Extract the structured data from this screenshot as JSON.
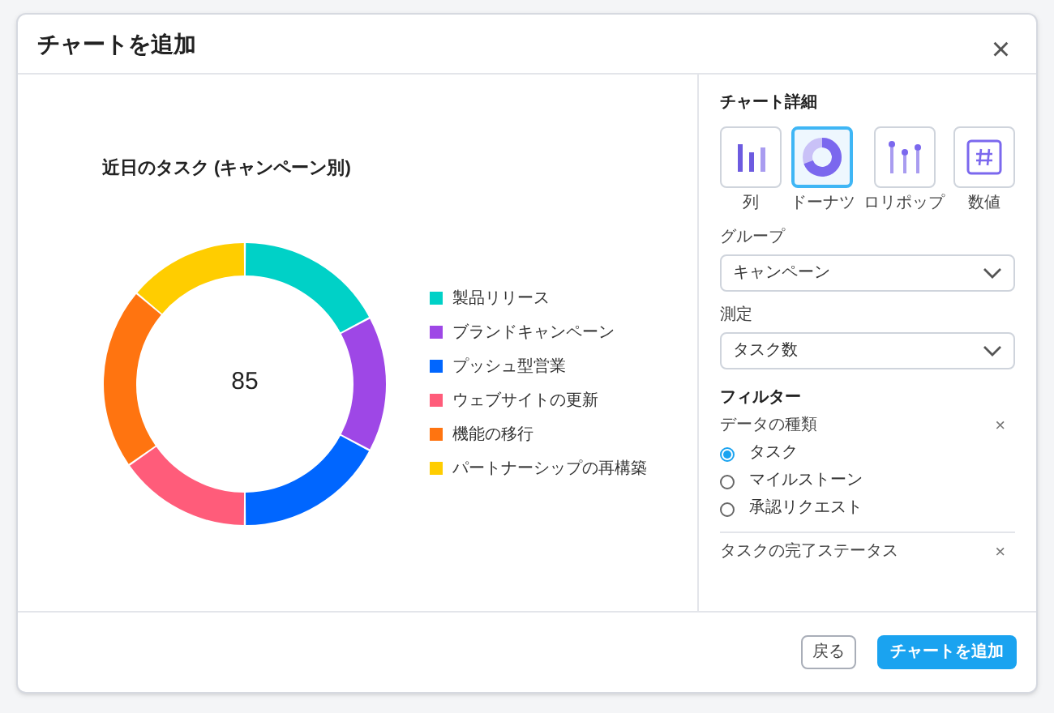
{
  "dialog": {
    "title": "チャートを追加",
    "close": "×"
  },
  "chart": {
    "title": "近日のタスク (キャンペーン別)",
    "center": "85",
    "legend": [
      {
        "label": "製品リリース",
        "color": "#00d1c7"
      },
      {
        "label": "ブランドキャンペーン",
        "color": "#9e47e6"
      },
      {
        "label": "プッシュ型営業",
        "color": "#0066ff"
      },
      {
        "label": "ウェブサイトの更新",
        "color": "#ff5c7a"
      },
      {
        "label": "機能の移行",
        "color": "#ff7410"
      },
      {
        "label": "パートナーシップの再構築",
        "color": "#ffcd00"
      }
    ]
  },
  "details": {
    "title": "チャート詳細",
    "types": [
      {
        "kind": "column",
        "label": "列",
        "selected": false
      },
      {
        "kind": "donut",
        "label": "ドーナツ",
        "selected": true
      },
      {
        "kind": "lollipop",
        "label": "ロリポップ",
        "selected": false
      },
      {
        "kind": "number",
        "label": "数値",
        "selected": false
      }
    ],
    "group": {
      "label": "グループ",
      "value": "キャンペーン"
    },
    "measure": {
      "label": "測定",
      "value": "タスク数"
    }
  },
  "filters": {
    "title": "フィルター",
    "sections": [
      {
        "label": "データの種類",
        "remove": "×",
        "options": [
          {
            "label": "タスク",
            "selected": true
          },
          {
            "label": "マイルストーン",
            "selected": false
          },
          {
            "label": "承認リクエスト",
            "selected": false
          }
        ]
      },
      {
        "label": "タスクの完了ステータス",
        "remove": "×"
      }
    ]
  },
  "footer": {
    "back": "戻る",
    "add": "チャートを追加"
  }
}
